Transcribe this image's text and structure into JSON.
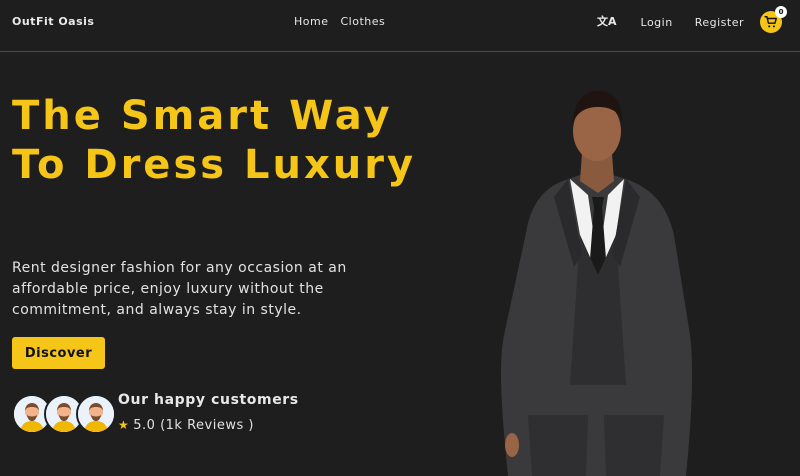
{
  "brand": {
    "name": "OutFit Oasis"
  },
  "nav": {
    "links": [
      "Home",
      "Clothes"
    ],
    "login": "Login",
    "register": "Register",
    "cart_count": "0",
    "translate_icon": "translate-icon"
  },
  "hero": {
    "title": "The Smart Way To Dress Luxury",
    "subtitle": "Rent designer fashion for any occasion at an affordable price, enjoy luxury without the commitment, and always stay in style.",
    "cta": "Discover"
  },
  "customers": {
    "label": "Our happy customers",
    "star": "★",
    "rating": "5.0",
    "reviews": "(1k Reviews )"
  },
  "colors": {
    "background": "#1e1e1e",
    "accent": "#f5c518",
    "text": "#ffffff"
  }
}
